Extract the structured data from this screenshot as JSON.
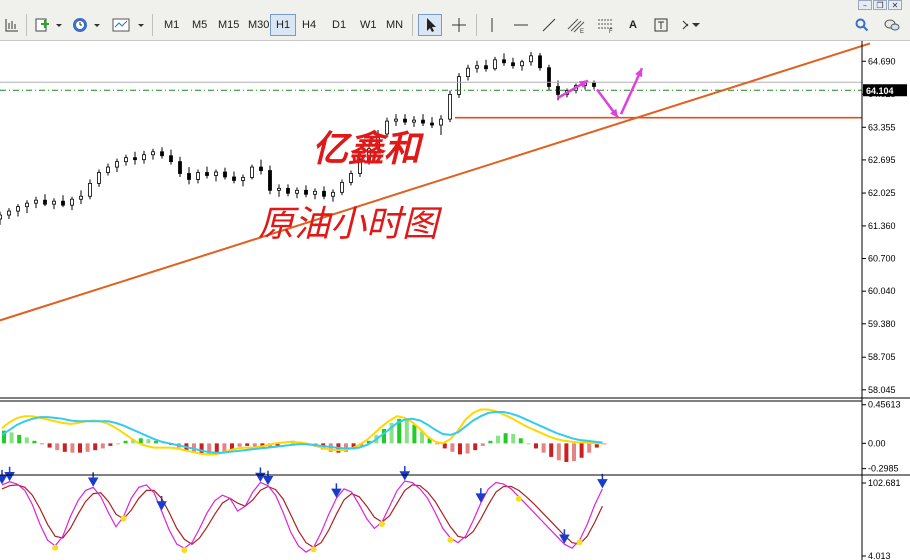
{
  "toolbar": {
    "timeframes": [
      "M1",
      "M5",
      "M15",
      "M30",
      "H1",
      "H4",
      "D1",
      "W1",
      "MN"
    ],
    "selected_timeframe": "H1",
    "text_tool": "A"
  },
  "colors": {
    "trendline": "#e06020",
    "support": "#e0501a",
    "watermark": "#e01818",
    "arrow": "#e040e0",
    "macd_up": "#22cc22",
    "macd_down": "#cc2020",
    "macd_fast": "#ffd800",
    "macd_slow": "#33ccee",
    "kdj_k": "#dd22dd",
    "kdj_d": "#aa2222",
    "kdj_down_marker": "#1a3ccc",
    "kdj_up_marker": "#f2e020"
  },
  "watermark": {
    "line1": "亿鑫和",
    "line2": "原油小时图"
  },
  "chart_data": {
    "type": "candlestick",
    "timeframe": "H1",
    "y_ticks": [
      "64.690",
      "64.025",
      "63.355",
      "62.695",
      "62.025",
      "61.360",
      "60.700",
      "60.040",
      "59.380",
      "58.705",
      "58.045"
    ],
    "ylim": [
      57.9,
      65.1
    ],
    "current_price": "64.104",
    "support_level": 63.55,
    "trendline": {
      "start": {
        "x": 0,
        "y": 59.45
      },
      "end": {
        "x": 290,
        "y": 65.05
      }
    },
    "candles": [
      {
        "x": 0,
        "o": 61.5,
        "h": 61.65,
        "l": 61.38,
        "c": 61.58
      },
      {
        "x": 3,
        "o": 61.58,
        "h": 61.72,
        "l": 61.5,
        "c": 61.66
      },
      {
        "x": 6,
        "o": 61.66,
        "h": 61.8,
        "l": 61.55,
        "c": 61.75
      },
      {
        "x": 9,
        "o": 61.75,
        "h": 61.88,
        "l": 61.62,
        "c": 61.82
      },
      {
        "x": 12,
        "o": 61.82,
        "h": 61.95,
        "l": 61.72,
        "c": 61.88
      },
      {
        "x": 15,
        "o": 61.88,
        "h": 62.0,
        "l": 61.76,
        "c": 61.8
      },
      {
        "x": 18,
        "o": 61.8,
        "h": 61.92,
        "l": 61.7,
        "c": 61.86
      },
      {
        "x": 21,
        "o": 61.86,
        "h": 61.98,
        "l": 61.74,
        "c": 61.78
      },
      {
        "x": 24,
        "o": 61.78,
        "h": 61.95,
        "l": 61.68,
        "c": 61.9
      },
      {
        "x": 27,
        "o": 61.9,
        "h": 62.08,
        "l": 61.8,
        "c": 61.96
      },
      {
        "x": 30,
        "o": 61.96,
        "h": 62.3,
        "l": 61.9,
        "c": 62.22
      },
      {
        "x": 33,
        "o": 62.22,
        "h": 62.5,
        "l": 62.15,
        "c": 62.44
      },
      {
        "x": 36,
        "o": 62.44,
        "h": 62.62,
        "l": 62.38,
        "c": 62.55
      },
      {
        "x": 39,
        "o": 62.55,
        "h": 62.72,
        "l": 62.45,
        "c": 62.66
      },
      {
        "x": 42,
        "o": 62.66,
        "h": 62.8,
        "l": 62.58,
        "c": 62.74
      },
      {
        "x": 45,
        "o": 62.74,
        "h": 62.86,
        "l": 62.6,
        "c": 62.7
      },
      {
        "x": 48,
        "o": 62.7,
        "h": 62.88,
        "l": 62.62,
        "c": 62.8
      },
      {
        "x": 51,
        "o": 62.8,
        "h": 62.92,
        "l": 62.7,
        "c": 62.86
      },
      {
        "x": 54,
        "o": 62.86,
        "h": 62.95,
        "l": 62.72,
        "c": 62.78
      },
      {
        "x": 57,
        "o": 62.78,
        "h": 62.9,
        "l": 62.6,
        "c": 62.66
      },
      {
        "x": 60,
        "o": 62.66,
        "h": 62.76,
        "l": 62.35,
        "c": 62.42
      },
      {
        "x": 63,
        "o": 62.42,
        "h": 62.55,
        "l": 62.2,
        "c": 62.3
      },
      {
        "x": 66,
        "o": 62.3,
        "h": 62.5,
        "l": 62.22,
        "c": 62.44
      },
      {
        "x": 69,
        "o": 62.44,
        "h": 62.56,
        "l": 62.32,
        "c": 62.38
      },
      {
        "x": 72,
        "o": 62.38,
        "h": 62.5,
        "l": 62.26,
        "c": 62.45
      },
      {
        "x": 75,
        "o": 62.45,
        "h": 62.54,
        "l": 62.3,
        "c": 62.35
      },
      {
        "x": 78,
        "o": 62.35,
        "h": 62.46,
        "l": 62.22,
        "c": 62.28
      },
      {
        "x": 81,
        "o": 62.28,
        "h": 62.4,
        "l": 62.16,
        "c": 62.34
      },
      {
        "x": 84,
        "o": 62.34,
        "h": 62.6,
        "l": 62.3,
        "c": 62.55
      },
      {
        "x": 87,
        "o": 62.55,
        "h": 62.7,
        "l": 62.4,
        "c": 62.48
      },
      {
        "x": 90,
        "o": 62.48,
        "h": 62.58,
        "l": 62.0,
        "c": 62.08
      },
      {
        "x": 93,
        "o": 62.08,
        "h": 62.2,
        "l": 61.95,
        "c": 62.12
      },
      {
        "x": 96,
        "o": 62.12,
        "h": 62.2,
        "l": 61.96,
        "c": 62.02
      },
      {
        "x": 99,
        "o": 62.02,
        "h": 62.14,
        "l": 61.92,
        "c": 62.08
      },
      {
        "x": 102,
        "o": 62.08,
        "h": 62.18,
        "l": 61.94,
        "c": 62.0
      },
      {
        "x": 105,
        "o": 62.0,
        "h": 62.12,
        "l": 61.9,
        "c": 62.06
      },
      {
        "x": 108,
        "o": 62.06,
        "h": 62.16,
        "l": 61.9,
        "c": 61.96
      },
      {
        "x": 111,
        "o": 61.96,
        "h": 62.1,
        "l": 61.85,
        "c": 62.04
      },
      {
        "x": 114,
        "o": 62.04,
        "h": 62.3,
        "l": 61.98,
        "c": 62.24
      },
      {
        "x": 117,
        "o": 62.24,
        "h": 62.48,
        "l": 62.18,
        "c": 62.42
      },
      {
        "x": 120,
        "o": 62.42,
        "h": 62.75,
        "l": 62.35,
        "c": 62.68
      },
      {
        "x": 123,
        "o": 62.68,
        "h": 63.0,
        "l": 62.6,
        "c": 62.92
      },
      {
        "x": 126,
        "o": 62.92,
        "h": 63.3,
        "l": 62.85,
        "c": 63.22
      },
      {
        "x": 129,
        "o": 63.22,
        "h": 63.55,
        "l": 63.15,
        "c": 63.48
      },
      {
        "x": 132,
        "o": 63.48,
        "h": 63.62,
        "l": 63.38,
        "c": 63.52
      },
      {
        "x": 135,
        "o": 63.52,
        "h": 63.62,
        "l": 63.4,
        "c": 63.46
      },
      {
        "x": 138,
        "o": 63.46,
        "h": 63.58,
        "l": 63.36,
        "c": 63.5
      },
      {
        "x": 141,
        "o": 63.5,
        "h": 63.62,
        "l": 63.38,
        "c": 63.44
      },
      {
        "x": 144,
        "o": 63.44,
        "h": 63.56,
        "l": 63.34,
        "c": 63.4
      },
      {
        "x": 147,
        "o": 63.4,
        "h": 63.6,
        "l": 63.2,
        "c": 63.52
      },
      {
        "x": 150,
        "o": 63.52,
        "h": 64.1,
        "l": 63.46,
        "c": 64.02
      },
      {
        "x": 153,
        "o": 64.02,
        "h": 64.45,
        "l": 63.95,
        "c": 64.38
      },
      {
        "x": 156,
        "o": 64.38,
        "h": 64.62,
        "l": 64.3,
        "c": 64.55
      },
      {
        "x": 159,
        "o": 64.55,
        "h": 64.7,
        "l": 64.46,
        "c": 64.6
      },
      {
        "x": 162,
        "o": 64.6,
        "h": 64.72,
        "l": 64.48,
        "c": 64.54
      },
      {
        "x": 165,
        "o": 64.54,
        "h": 64.78,
        "l": 64.5,
        "c": 64.72
      },
      {
        "x": 168,
        "o": 64.72,
        "h": 64.85,
        "l": 64.6,
        "c": 64.66
      },
      {
        "x": 171,
        "o": 64.66,
        "h": 64.76,
        "l": 64.54,
        "c": 64.6
      },
      {
        "x": 174,
        "o": 64.6,
        "h": 64.72,
        "l": 64.5,
        "c": 64.68
      },
      {
        "x": 177,
        "o": 64.68,
        "h": 64.88,
        "l": 64.6,
        "c": 64.8
      },
      {
        "x": 180,
        "o": 64.8,
        "h": 64.86,
        "l": 64.5,
        "c": 64.56
      },
      {
        "x": 183,
        "o": 64.56,
        "h": 64.62,
        "l": 64.1,
        "c": 64.18
      },
      {
        "x": 186,
        "o": 64.18,
        "h": 64.3,
        "l": 63.9,
        "c": 64.02
      },
      {
        "x": 189,
        "o": 64.02,
        "h": 64.14,
        "l": 63.96,
        "c": 64.1
      },
      {
        "x": 192,
        "o": 64.1,
        "h": 64.24,
        "l": 64.04,
        "c": 64.2
      },
      {
        "x": 195,
        "o": 64.2,
        "h": 64.3,
        "l": 64.12,
        "c": 64.25
      },
      {
        "x": 198,
        "o": 64.25,
        "h": 64.3,
        "l": 64.12,
        "c": 64.18
      }
    ],
    "arrows": [
      {
        "from": {
          "x": 186,
          "y": 63.95
        },
        "to": {
          "x": 196,
          "y": 64.3
        }
      },
      {
        "from": {
          "x": 199,
          "y": 64.12
        },
        "to": {
          "x": 206,
          "y": 63.55
        }
      },
      {
        "from": {
          "x": 207,
          "y": 63.62
        },
        "to": {
          "x": 214,
          "y": 64.55
        }
      }
    ],
    "macd": {
      "y_ticks": [
        "0.45613",
        "0.00",
        "-0.2985"
      ],
      "ylim": [
        -0.35,
        0.5
      ],
      "histogram": [
        0.15,
        0.13,
        0.1,
        0.07,
        0.03,
        -0.01,
        -0.05,
        -0.08,
        -0.1,
        -0.11,
        -0.11,
        -0.1,
        -0.08,
        -0.06,
        -0.03,
        0.0,
        0.03,
        0.05,
        0.06,
        0.05,
        0.03,
        0.01,
        -0.02,
        -0.05,
        -0.08,
        -0.11,
        -0.13,
        -0.14,
        -0.13,
        -0.1,
        -0.07,
        -0.04,
        -0.03,
        -0.04,
        -0.06,
        -0.05,
        -0.03,
        0.01,
        0.03,
        0.02,
        -0.01,
        -0.04,
        -0.07,
        -0.1,
        -0.11,
        -0.1,
        -0.07,
        -0.03,
        0.03,
        0.1,
        0.17,
        0.24,
        0.29,
        0.28,
        0.22,
        0.14,
        0.06,
        -0.01,
        -0.06,
        -0.1,
        -0.13,
        -0.12,
        -0.08,
        -0.03,
        0.03,
        0.09,
        0.12,
        0.11,
        0.06,
        0.0,
        -0.06,
        -0.11,
        -0.16,
        -0.2,
        -0.22,
        -0.21,
        -0.17,
        -0.11,
        -0.05,
        -0.01
      ],
      "fast": [
        0.18,
        0.25,
        0.3,
        0.32,
        0.32,
        0.3,
        0.28,
        0.26,
        0.24,
        0.23,
        0.24,
        0.26,
        0.27,
        0.26,
        0.23,
        0.18,
        0.12,
        0.06,
        0.0,
        -0.03,
        -0.05,
        -0.05,
        -0.05,
        -0.06,
        -0.08,
        -0.1,
        -0.12,
        -0.13,
        -0.13,
        -0.11,
        -0.08,
        -0.06,
        -0.05,
        -0.05,
        -0.04,
        -0.02,
        0.0,
        0.01,
        0.02,
        0.01,
        0.0,
        -0.02,
        -0.05,
        -0.07,
        -0.08,
        -0.08,
        -0.06,
        -0.02,
        0.04,
        0.12,
        0.2,
        0.27,
        0.32,
        0.3,
        0.25,
        0.17,
        0.08,
        0.02,
        0.0,
        0.05,
        0.15,
        0.28,
        0.36,
        0.4,
        0.4,
        0.38,
        0.34,
        0.3,
        0.25,
        0.2,
        0.16,
        0.12,
        0.08,
        0.05,
        0.03,
        0.02,
        0.01,
        0.01,
        0.0,
        0.0
      ],
      "slow": [
        0.1,
        0.16,
        0.22,
        0.26,
        0.29,
        0.31,
        0.31,
        0.3,
        0.29,
        0.27,
        0.26,
        0.26,
        0.26,
        0.26,
        0.26,
        0.24,
        0.21,
        0.17,
        0.13,
        0.09,
        0.05,
        0.02,
        0.0,
        -0.02,
        -0.04,
        -0.06,
        -0.08,
        -0.1,
        -0.11,
        -0.11,
        -0.1,
        -0.09,
        -0.08,
        -0.07,
        -0.06,
        -0.05,
        -0.04,
        -0.03,
        -0.02,
        -0.01,
        -0.01,
        -0.02,
        -0.03,
        -0.04,
        -0.05,
        -0.06,
        -0.06,
        -0.05,
        -0.02,
        0.03,
        0.1,
        0.17,
        0.24,
        0.28,
        0.29,
        0.27,
        0.22,
        0.16,
        0.11,
        0.1,
        0.13,
        0.2,
        0.27,
        0.32,
        0.36,
        0.37,
        0.37,
        0.35,
        0.32,
        0.28,
        0.24,
        0.2,
        0.16,
        0.12,
        0.09,
        0.06,
        0.04,
        0.03,
        0.02,
        0.01
      ]
    },
    "kdj": {
      "y_ticks": [
        "102.681",
        "4.013"
      ],
      "ylim": [
        0,
        105
      ],
      "k": [
        95,
        99,
        96,
        88,
        70,
        45,
        25,
        18,
        30,
        55,
        75,
        88,
        92,
        80,
        60,
        42,
        55,
        78,
        92,
        95,
        85,
        62,
        38,
        20,
        15,
        22,
        40,
        60,
        75,
        82,
        78,
        62,
        68,
        86,
        98,
        94,
        82,
        60,
        35,
        18,
        10,
        16,
        35,
        58,
        78,
        90,
        86,
        70,
        52,
        40,
        48,
        68,
        88,
        100,
        98,
        90,
        78,
        60,
        40,
        28,
        22,
        30,
        50,
        72,
        90,
        98,
        96,
        90,
        80,
        70,
        60,
        50,
        40,
        30,
        20,
        15,
        25,
        45,
        70,
        90
      ],
      "d": [
        90,
        94,
        95,
        92,
        82,
        65,
        45,
        30,
        28,
        40,
        58,
        74,
        84,
        85,
        74,
        58,
        52,
        63,
        78,
        88,
        88,
        78,
        60,
        40,
        26,
        20,
        28,
        42,
        58,
        72,
        78,
        72,
        68,
        76,
        88,
        93,
        89,
        77,
        57,
        37,
        22,
        16,
        22,
        38,
        58,
        76,
        84,
        80,
        68,
        54,
        48,
        56,
        72,
        88,
        95,
        94,
        86,
        74,
        58,
        42,
        30,
        28,
        36,
        52,
        70,
        86,
        93,
        93,
        88,
        80,
        71,
        61,
        51,
        41,
        31,
        22,
        20,
        30,
        48,
        68
      ],
      "down_markers": [
        0,
        1,
        12,
        21,
        34,
        35,
        44,
        53,
        63,
        74,
        79
      ],
      "up_markers": [
        7,
        16,
        24,
        41,
        50,
        59,
        68,
        76
      ]
    }
  }
}
